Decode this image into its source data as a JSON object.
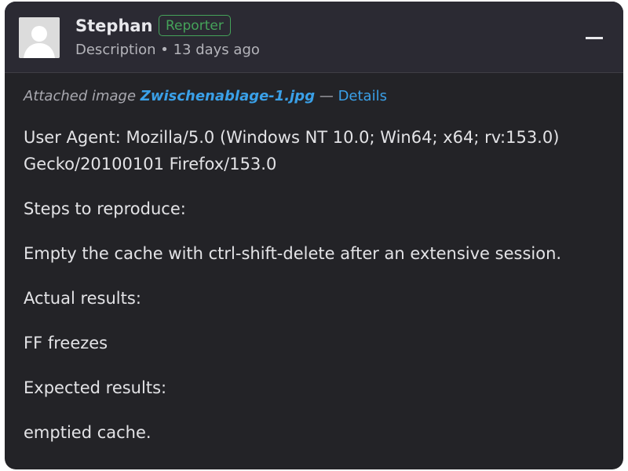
{
  "comment": {
    "author": "Stephan",
    "badge": "Reporter",
    "meta": "Description • 13 days ago",
    "collapse_icon": "minus-icon",
    "attachment": {
      "prefix": "Attached image",
      "filename": "Zwischenablage-1.jpg",
      "separator": "—",
      "details_label": "Details"
    },
    "paragraphs": [
      "User Agent: Mozilla/5.0 (Windows NT 10.0; Win64; x64; rv:153.0) Gecko/20100101 Firefox/153.0",
      "Steps to reproduce:",
      "Empty the cache with ctrl-shift-delete after an extensive session.",
      "Actual results:",
      "FF freezes",
      "Expected results:",
      "emptied cache."
    ]
  },
  "colors": {
    "card_background": "#232327",
    "header_background": "#2b2a33",
    "badge": "#45a35a",
    "link": "#3aa0e8"
  }
}
